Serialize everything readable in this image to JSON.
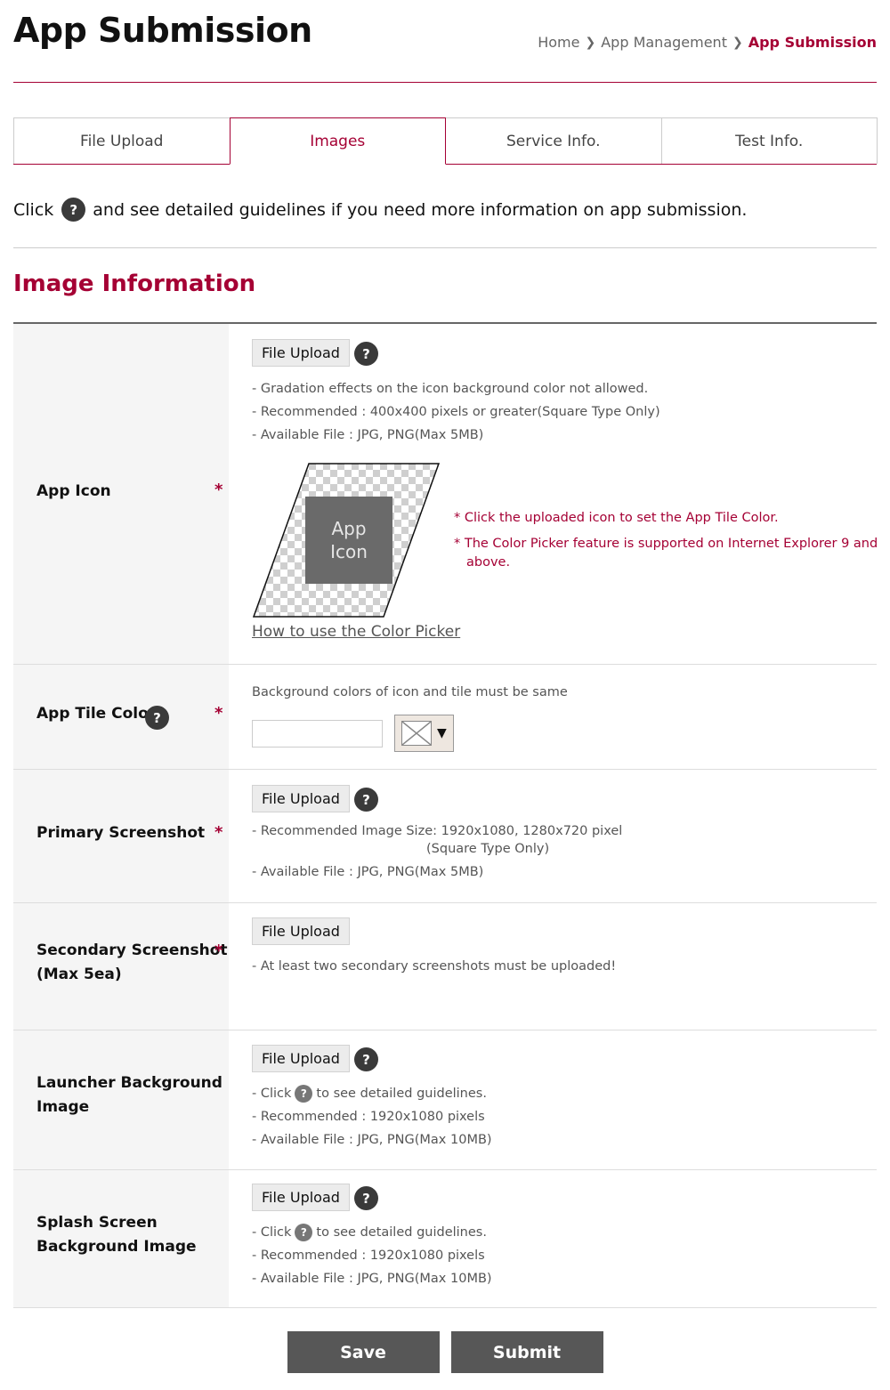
{
  "page": {
    "title": "App Submission",
    "breadcrumb": [
      "Home",
      "App Management",
      "App Submission"
    ],
    "intro_before": "Click",
    "intro_after": "and see detailed guidelines if you need more information on app submission."
  },
  "tabs": [
    "File Upload",
    "Images",
    "Service Info.",
    "Test Info."
  ],
  "active_tab": "Images",
  "section": {
    "title": "Image Information"
  },
  "help_glyph": "?",
  "required_mark": "*",
  "upload_label": "File Upload",
  "rows": {
    "app_icon": {
      "label": "App Icon",
      "notes": [
        "- Gradation effects on the icon background color not allowed.",
        "- Recommended : 400x400 pixels or greater(Square Type Only)",
        "- Available File : JPG, PNG(Max 5MB)"
      ],
      "placeholder": [
        "App",
        "Icon"
      ],
      "red_notes": [
        "* Click the uploaded icon to set the App Tile Color.",
        "* The Color Picker feature is supported on Internet Explorer 9 and",
        "above."
      ],
      "picker_link": "How to use the Color Picker"
    },
    "app_tile_color": {
      "label": "App Tile Color",
      "note": "Background colors of icon and tile must be same",
      "value": ""
    },
    "primary_screenshot": {
      "label": "Primary Screenshot",
      "notes": [
        "- Recommended Image Size: 1920x1080, 1280x720 pixel",
        "(Square Type Only)",
        "- Available File : JPG, PNG(Max 5MB)"
      ]
    },
    "secondary_screenshot": {
      "label_1": "Secondary Screenshot",
      "label_2": "(Max 5ea)",
      "note": "- At least two secondary screenshots must be uploaded!"
    },
    "launcher_bg": {
      "label_1": "Launcher Background",
      "label_2": "Image",
      "click_before": "- Click",
      "click_after": "to see detailed guidelines.",
      "notes": [
        "- Recommended : 1920x1080 pixels",
        "- Available File : JPG, PNG(Max 10MB)"
      ]
    },
    "splash_bg": {
      "label_1": "Splash Screen",
      "label_2": "Background Image",
      "click_before": "- Click",
      "click_after": "to see detailed guidelines.",
      "notes": [
        "- Recommended : 1920x1080 pixels",
        "- Available File : JPG, PNG(Max 10MB)"
      ]
    }
  },
  "actions": {
    "save": "Save",
    "submit": "Submit"
  },
  "colors": {
    "accent": "#a50034",
    "label_bg": "#f5f5f5",
    "action_button": "#575757",
    "help_icon": "#3a3a3a"
  },
  "icons": [
    "help-icon",
    "chevron-right-icon",
    "dropdown-arrow-icon",
    "app-icon-placeholder"
  ]
}
